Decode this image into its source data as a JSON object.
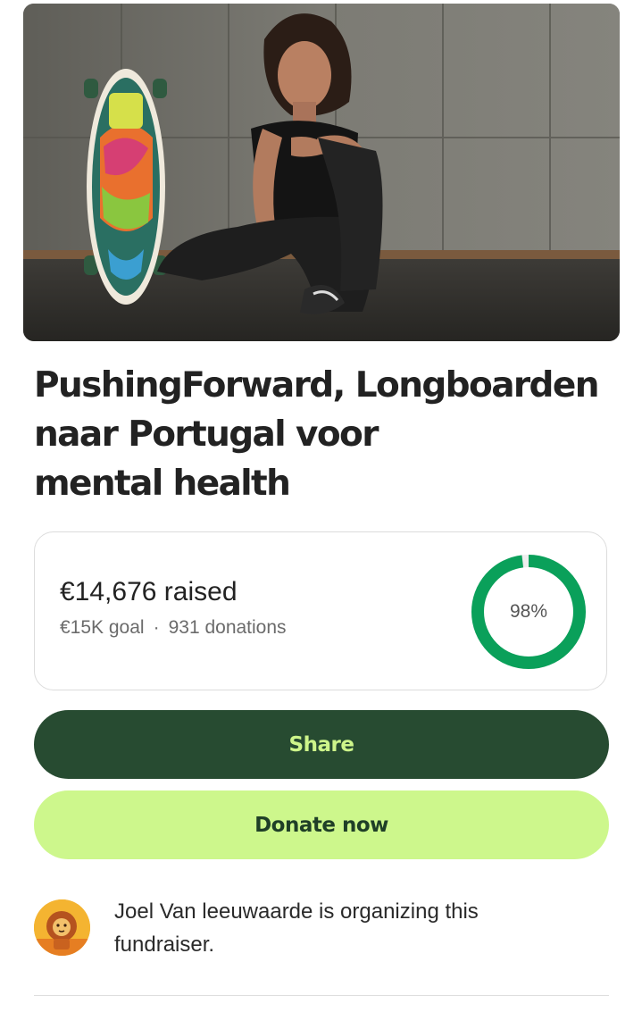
{
  "fundraiser": {
    "title_line1": "PushingForward, Longboarden",
    "title_line2": "naar Portugal voor",
    "title_line3": "mental health"
  },
  "progress": {
    "raised_amount": "€14,676",
    "raised_suffix": "raised",
    "goal": "€15K goal",
    "separator": "·",
    "donations": "931 donations",
    "percent_label": "98%",
    "percent_value": 0.98,
    "ring_color": "#0aa05a",
    "ring_track_color": "#eeeeee"
  },
  "actions": {
    "share_label": "Share",
    "donate_label": "Donate now"
  },
  "organizer": {
    "text": "Joel Van leeuwaarde is organizing this fundraiser.",
    "avatar_icon": "lion-illustration-icon"
  },
  "colors": {
    "share_bg": "#274b31",
    "share_text": "#cdf58a",
    "donate_bg": "#cdf78c",
    "donate_text": "#1f3f27"
  }
}
